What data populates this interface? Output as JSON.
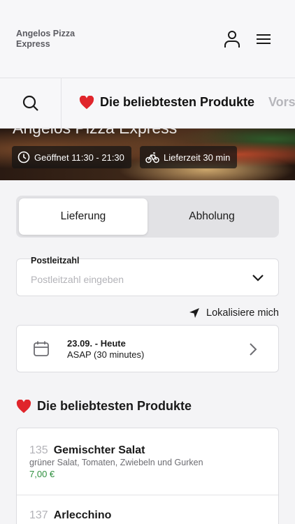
{
  "header": {
    "brand": "Angelos Pizza Express"
  },
  "categories": {
    "active_label": "Die beliebtesten Produkte",
    "next_label": "Vors"
  },
  "hero": {
    "title": "Angelos Pizza Express",
    "open_hours": "Geöffnet 11:30 - 21:30",
    "delivery_time": "Lieferzeit 30 min"
  },
  "order_type": {
    "delivery": "Lieferung",
    "pickup": "Abholung"
  },
  "zip": {
    "label": "Postleitzahl",
    "placeholder": "Postleitzahl eingeben"
  },
  "locate": {
    "label": "Lokalisiere mich"
  },
  "date": {
    "main": "23.09. - Heute",
    "sub": "ASAP (30 minutes)"
  },
  "section": {
    "title": "Die beliebtesten Produkte"
  },
  "products": [
    {
      "number": "135",
      "name": "Gemischter Salat",
      "description": "grüner Salat, Tomaten, Zwiebeln und Gurken",
      "price": "7,00 €"
    },
    {
      "number": "137",
      "name": "Arlecchino"
    }
  ],
  "colors": {
    "price": "#2f8f3e",
    "heart": "#e0252b",
    "muted": "#b3b3b8"
  }
}
